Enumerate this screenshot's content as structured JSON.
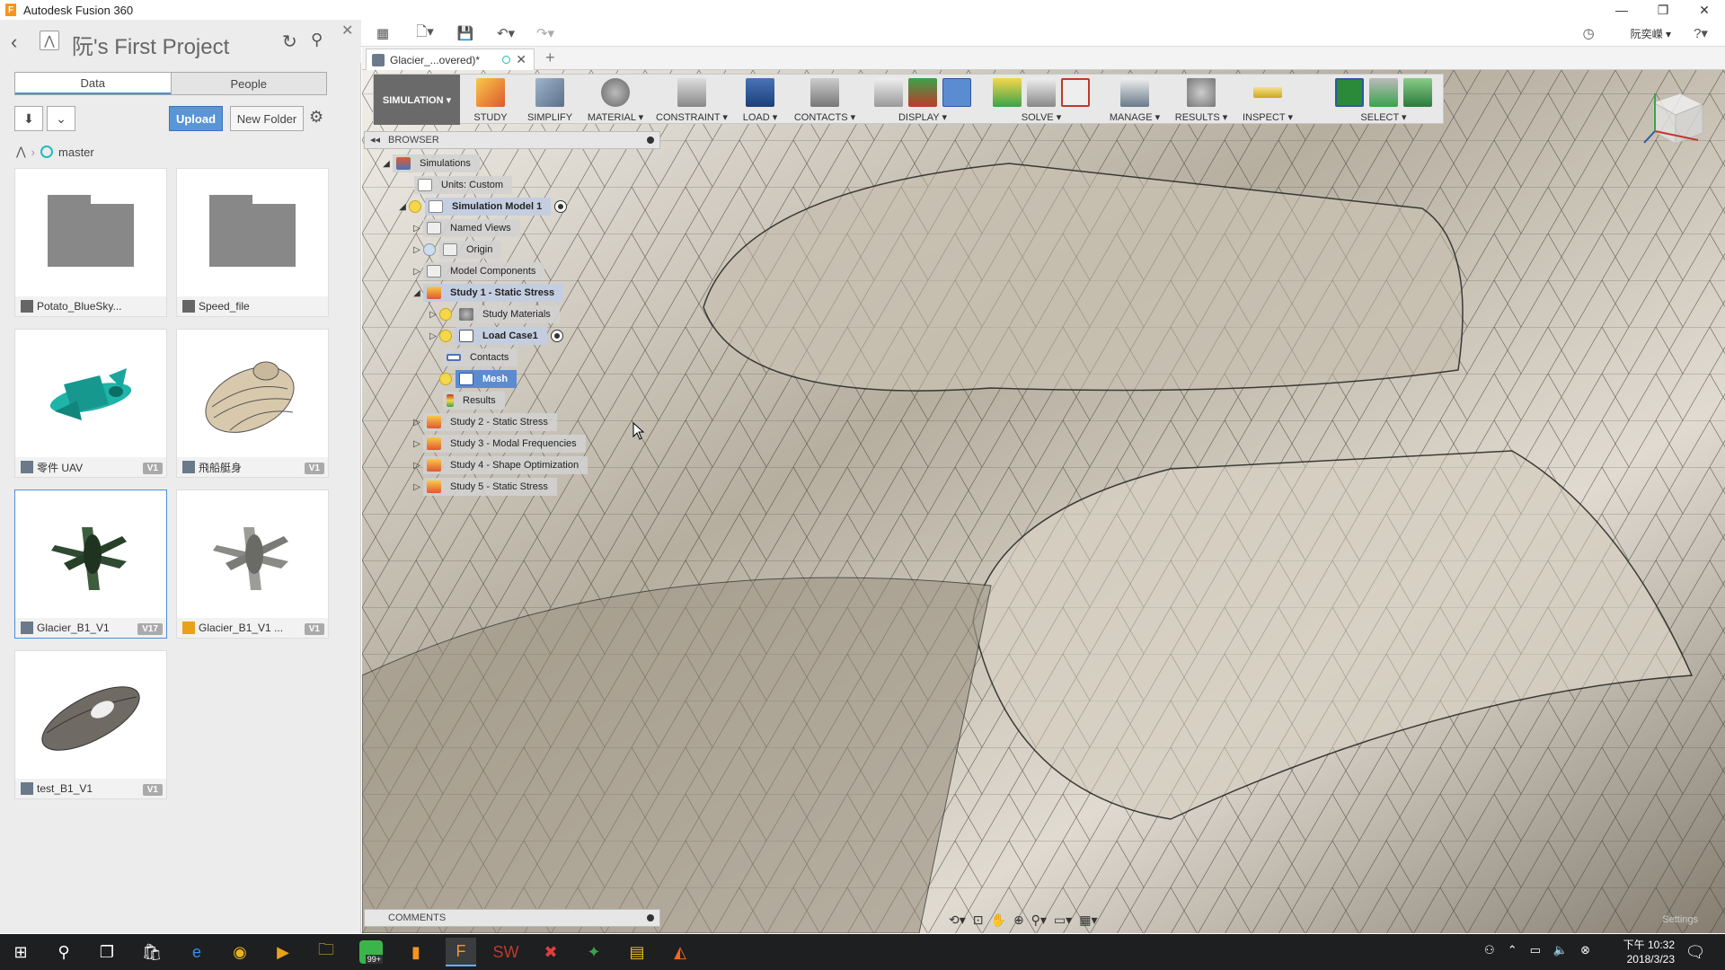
{
  "window": {
    "title": "Autodesk Fusion 360"
  },
  "appbar": {
    "user": "阮奕嶸 ▾"
  },
  "data_panel": {
    "project_title": "阮's First Project",
    "tabs": [
      "Data",
      "People"
    ],
    "upload_label": "Upload",
    "new_folder_label": "New Folder",
    "branch": "master",
    "items": [
      {
        "name": "Potato_BlueSky...",
        "type": "folder",
        "version": ""
      },
      {
        "name": "Speed_file",
        "type": "folder",
        "version": ""
      },
      {
        "name": "零件 UAV",
        "type": "design",
        "version": "V1"
      },
      {
        "name": "飛船艇身",
        "type": "design",
        "version": "V1"
      },
      {
        "name": "Glacier_B1_V1",
        "type": "design",
        "version": "V17"
      },
      {
        "name": "Glacier_B1_V1 ...",
        "type": "simulation",
        "version": "V1"
      },
      {
        "name": "test_B1_V1",
        "type": "design",
        "version": "V1"
      }
    ]
  },
  "doc_tab": {
    "label": "Glacier_...overed)*"
  },
  "toolbar": {
    "workspace": "SIMULATION ▾",
    "groups": [
      "STUDY",
      "SIMPLIFY",
      "MATERIAL ▾",
      "CONSTRAINT ▾",
      "LOAD ▾",
      "CONTACTS ▾",
      "DISPLAY ▾",
      "SOLVE ▾",
      "MANAGE ▾",
      "RESULTS ▾",
      "INSPECT ▾",
      "SELECT ▾"
    ]
  },
  "browser": {
    "header": "BROWSER",
    "nodes": [
      {
        "label": "Simulations"
      },
      {
        "label": "Units: Custom"
      },
      {
        "label": "Simulation Model 1"
      },
      {
        "label": "Named Views"
      },
      {
        "label": "Origin"
      },
      {
        "label": "Model Components"
      },
      {
        "label": "Study 1 - Static Stress"
      },
      {
        "label": "Study Materials"
      },
      {
        "label": "Load Case1"
      },
      {
        "label": "Contacts"
      },
      {
        "label": "Mesh"
      },
      {
        "label": "Results"
      },
      {
        "label": "Study 2 - Static Stress"
      },
      {
        "label": "Study 3 - Modal Frequencies"
      },
      {
        "label": "Study 4 - Shape Optimization"
      },
      {
        "label": "Study 5 - Static Stress"
      }
    ]
  },
  "comments": {
    "header": "COMMENTS"
  },
  "viewport": {
    "settings_label": "Settings"
  },
  "taskbar": {
    "badge": "99+",
    "time": "10:32",
    "ampm": "下午",
    "date": "2018/3/23"
  }
}
